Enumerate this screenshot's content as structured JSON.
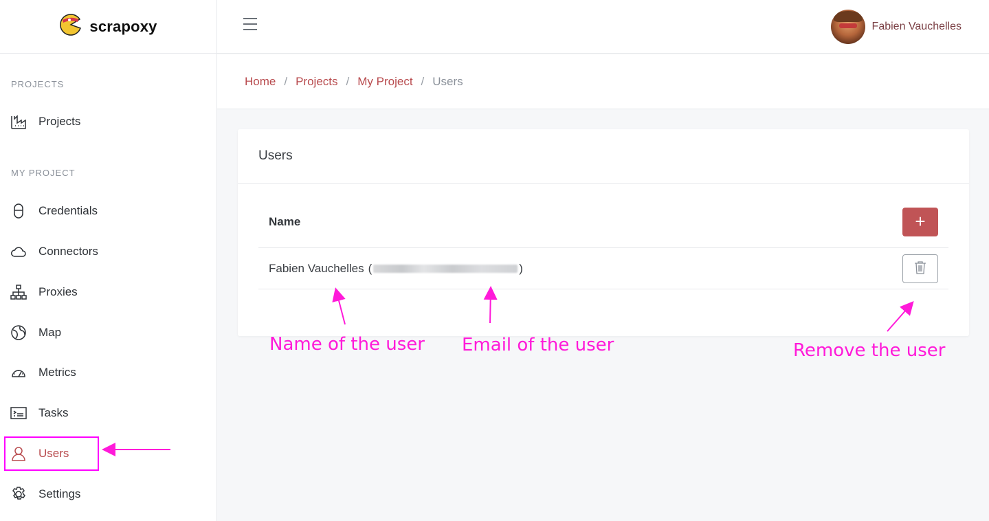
{
  "brand": {
    "name": "scrapoxy"
  },
  "topbar": {
    "user_name": "Fabien Vauchelles"
  },
  "sidebar": {
    "section_projects": "PROJECTS",
    "section_my_project": "MY PROJECT",
    "items": [
      {
        "label": "Projects",
        "icon": "factory-icon"
      },
      {
        "label": "Credentials",
        "icon": "lock-icon"
      },
      {
        "label": "Connectors",
        "icon": "cloud-icon"
      },
      {
        "label": "Proxies",
        "icon": "sitemap-icon"
      },
      {
        "label": "Map",
        "icon": "globe-icon"
      },
      {
        "label": "Metrics",
        "icon": "speedometer-icon"
      },
      {
        "label": "Tasks",
        "icon": "terminal-icon"
      },
      {
        "label": "Users",
        "icon": "user-icon",
        "active": true
      },
      {
        "label": "Settings",
        "icon": "gear-icon"
      }
    ]
  },
  "breadcrumb": [
    "Home",
    "Projects",
    "My Project",
    "Users"
  ],
  "card": {
    "title": "Users",
    "column_name": "Name",
    "add_label": "+",
    "rows": [
      {
        "name": "Fabien Vauchelles",
        "open_paren": "(",
        "close_paren": ")"
      }
    ]
  },
  "annotations": {
    "name": "Name of the user",
    "email": "Email of the user",
    "remove": "Remove the user"
  },
  "colors": {
    "accent": "#b84b4e",
    "annotation": "#ff1ad9"
  }
}
